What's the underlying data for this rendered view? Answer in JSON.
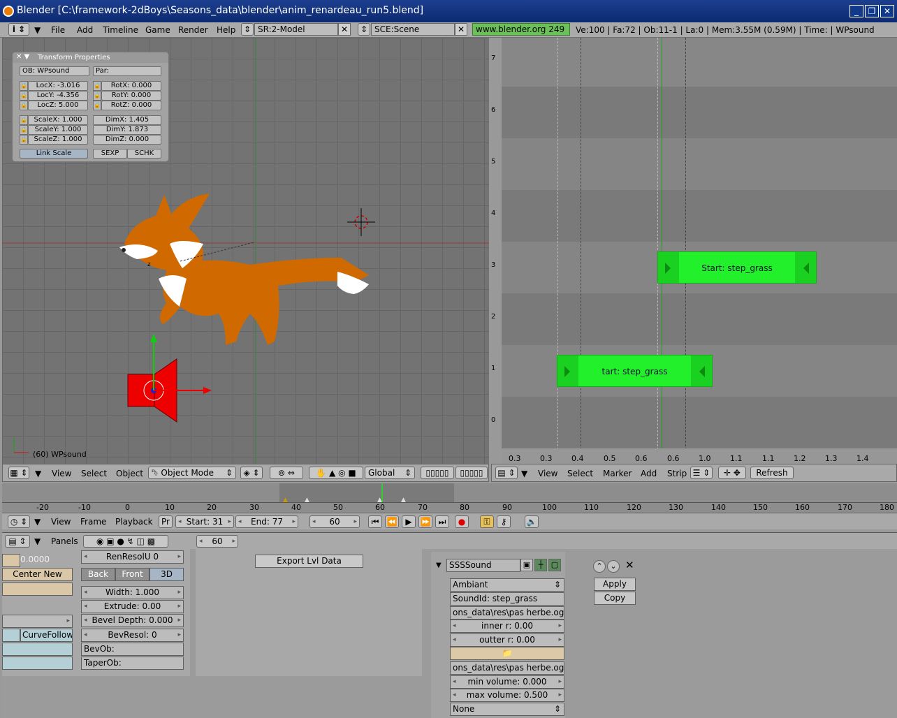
{
  "window": {
    "title": "Blender [C:\\framework-2dBoys\\Seasons_data\\blender\\anim_renardeau_run5.blend]",
    "min": "_",
    "max": "❐",
    "close": "✕"
  },
  "main_header": {
    "info_icon": "i",
    "menus": [
      "File",
      "Add",
      "Timeline",
      "Game",
      "Render",
      "Help"
    ],
    "screen": "SR:2-Model",
    "scene": "SCE:Scene",
    "url": "www.blender.org 249",
    "stats": "Ve:100 | Fa:72 | Ob:11-1 | La:0 | Mem:3.55M (0.59M) | Time: | WPsound"
  },
  "transform": {
    "title": "Transform Properties",
    "ob": "OB: WPsound",
    "par": "Par:",
    "locx": "LocX: -3.016",
    "locy": "LocY: -4.356",
    "locz": "LocZ: 5.000",
    "rotx": "RotX: 0.000",
    "roty": "RotY: 0.000",
    "rotz": "RotZ: 0.000",
    "scalex": "ScaleX: 1.000",
    "scaley": "ScaleY: 1.000",
    "scalez": "ScaleZ: 1.000",
    "dimx": "DimX: 1.405",
    "dimy": "DimY: 1.873",
    "dimz": "DimZ: 0.000",
    "link_scale": "Link Scale",
    "sexp": "SEXP",
    "schk": "SCHK"
  },
  "view3d": {
    "axis_z": "z",
    "object_label": "(60) WPsound",
    "menus": [
      "View",
      "Select",
      "Object"
    ],
    "mode": "Object Mode",
    "orientation": "Global"
  },
  "sequencer": {
    "rows": [
      "7",
      "6",
      "5",
      "4",
      "3",
      "2",
      "1",
      "0"
    ],
    "strip_a": "Start: step_grass",
    "strip_b": "tart: step_grass",
    "ticks": [
      "0.3",
      "0.3",
      "0.4",
      "0.5",
      "0.6",
      "0.6",
      "1.0",
      "1.1",
      "1.1",
      "1.2",
      "1.3",
      "1.4"
    ],
    "menus": [
      "View",
      "Select",
      "Marker",
      "Add",
      "Strip"
    ],
    "refresh": "Refresh"
  },
  "timeline": {
    "ticks": [
      "-20",
      "-10",
      "0",
      "10",
      "20",
      "30",
      "40",
      "50",
      "60",
      "70",
      "80",
      "90",
      "100",
      "110",
      "120",
      "130",
      "140",
      "150",
      "160",
      "170",
      "180"
    ],
    "menus": [
      "View",
      "Frame",
      "Playback"
    ],
    "pr": "Pr",
    "start": "Start: 31",
    "end": "End: 77",
    "frame": "60"
  },
  "buttons": {
    "panels_label": "Panels",
    "frame": "60",
    "value": "0.0000",
    "center_new": "Center New",
    "curvefollow": "CurveFollow",
    "renresol": "RenResolU 0",
    "back": "Back",
    "front": "Front",
    "three_d": "3D",
    "width": "Width: 1.000",
    "extrude": "Extrude: 0.00",
    "bevel_depth": "Bevel Depth: 0.000",
    "bevresol": "BevResol: 0",
    "bevob": "BevOb:",
    "taperob": "TaperOb:",
    "export": "Export Lvl Data"
  },
  "sound": {
    "name": "SSSSound",
    "type": "Ambiant",
    "soundid": "SoundId: step_grass",
    "file1": "ons_data\\res\\pas herbe.ogg",
    "inner": "inner r: 0.00",
    "outter": "outter r: 0.00",
    "file2": "ons_data\\res\\pas herbe.ogg",
    "minvol": "min volume: 0.000",
    "maxvol": "max volume: 0.500",
    "none": "None",
    "apply": "Apply",
    "copy": "Copy"
  }
}
